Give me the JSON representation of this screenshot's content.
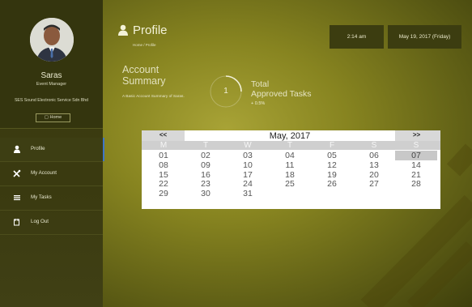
{
  "user": {
    "name": "Saras",
    "role": "Event Manager",
    "company": "SES Sound Electronic Service Sdn Bhd",
    "home_label": "Home"
  },
  "nav": [
    {
      "label": "Profile",
      "icon": "user-icon",
      "active": true
    },
    {
      "label": "My Account",
      "icon": "tools-icon"
    },
    {
      "label": "My Tasks",
      "icon": "list-icon"
    },
    {
      "label": "Log Out",
      "icon": "logout-icon"
    }
  ],
  "header": {
    "title": "Profile",
    "breadcrumb": "Home  /  Profile",
    "time": "2:14 am",
    "date": "May 19, 2017 (Friday)"
  },
  "summary": {
    "title_line1": "Account",
    "title_line2": "Summary",
    "subtitle": "A Basic Account Summary of Saras.",
    "tasks_value": "1",
    "tasks_label_line1": "Total",
    "tasks_label_line2": "Approved Tasks",
    "tasks_delta": "+ 0.5%"
  },
  "calendar": {
    "prev": "<<",
    "next": ">>",
    "month": "May, 2017",
    "days_of_week": [
      "M",
      "T",
      "W",
      "T",
      "F",
      "S",
      "S"
    ],
    "weeks": [
      [
        "01",
        "02",
        "03",
        "04",
        "05",
        "06",
        "07"
      ],
      [
        "08",
        "09",
        "10",
        "11",
        "12",
        "13",
        "14"
      ],
      [
        "15",
        "16",
        "17",
        "18",
        "19",
        "20",
        "21"
      ],
      [
        "22",
        "23",
        "24",
        "25",
        "26",
        "27",
        "28"
      ],
      [
        "29",
        "30",
        "31",
        "",
        "",
        "",
        ""
      ]
    ],
    "selected": "07"
  },
  "colors": {
    "accent": "#3e76c8",
    "sidebar": "#3a3a10",
    "background": "#878420"
  }
}
